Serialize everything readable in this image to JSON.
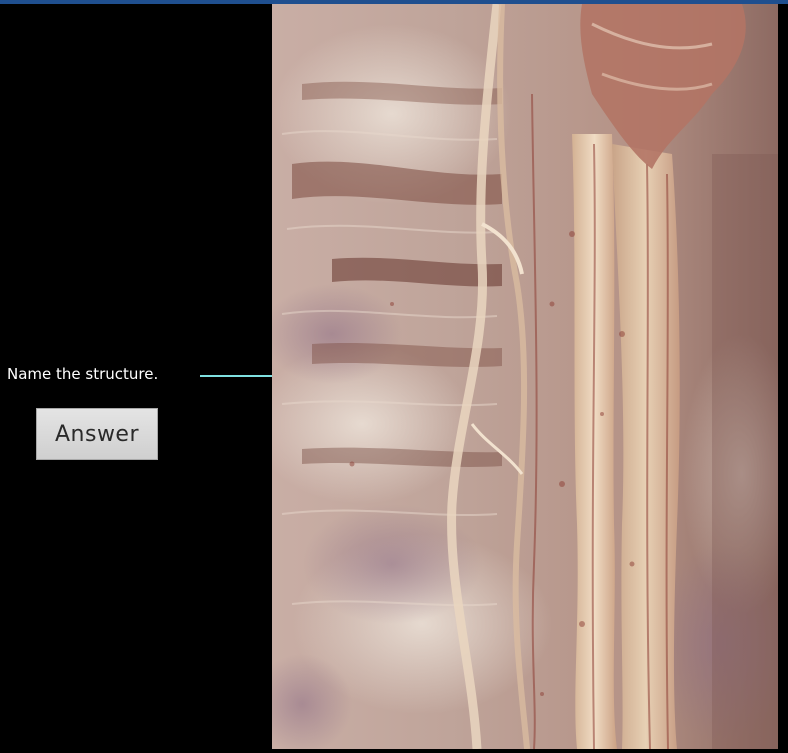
{
  "quiz": {
    "question": "Name the structure.",
    "answer_label": "Answer"
  },
  "colors": {
    "background": "#000000",
    "top_bar": "#1f4f8f",
    "pointer": "#22d3d3",
    "label_text": "#ffffff",
    "button_bg": "#d9d9d9"
  },
  "specimen": {
    "subject": "anatomical dissection photograph (posterior thoracic wall with sympathetic trunk)",
    "icon": "photo-image"
  }
}
